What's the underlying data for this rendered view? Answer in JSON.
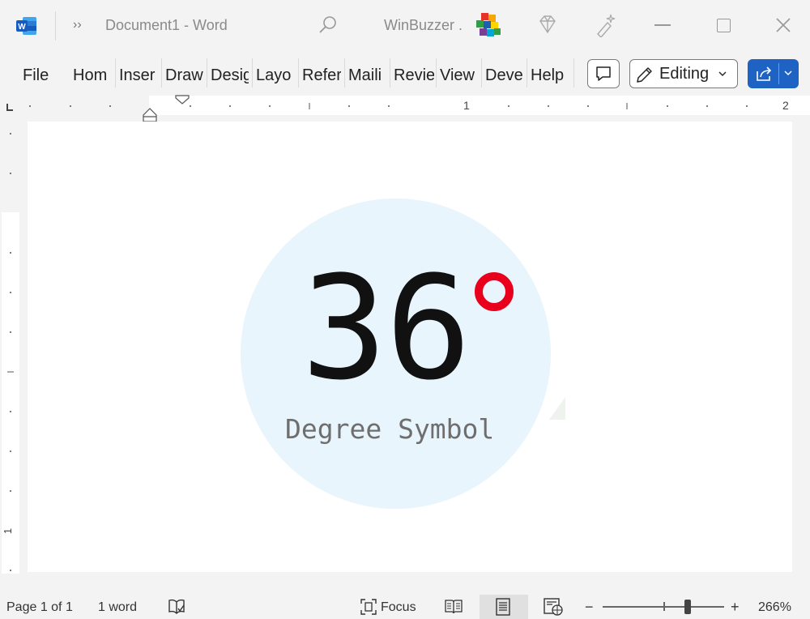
{
  "titlebar": {
    "app_icon": "word-icon",
    "more_label": "››",
    "document_title": "Document1  -  Word",
    "account_name": "WinBuzzer .",
    "icons": [
      "search-icon",
      "diamond-icon",
      "designer-wand-icon",
      "minimize-icon",
      "maximize-icon",
      "close-icon"
    ]
  },
  "ribbon": {
    "tabs": [
      "File",
      "Hom",
      "Inser",
      "Draw",
      "Desig",
      "Layo",
      "Refer",
      "Maili",
      "Revie",
      "View",
      "Deve",
      "Help"
    ],
    "editing_label": "Editing",
    "comment_icon": "comment-icon",
    "share_icon": "share-icon"
  },
  "ruler": {
    "h_labels": [
      "1",
      "2"
    ],
    "v_labels": [
      "1"
    ]
  },
  "document": {
    "number": "36",
    "subtitle": "Degree Symbol",
    "colors": {
      "circle": "#e8f5fc",
      "degree": "#e8001c",
      "number": "#111111"
    }
  },
  "statusbar": {
    "page": "Page 1 of 1",
    "words": "1 word",
    "focus_label": "Focus",
    "zoom_minus": "−",
    "zoom_plus": "+",
    "zoom": "266%"
  }
}
